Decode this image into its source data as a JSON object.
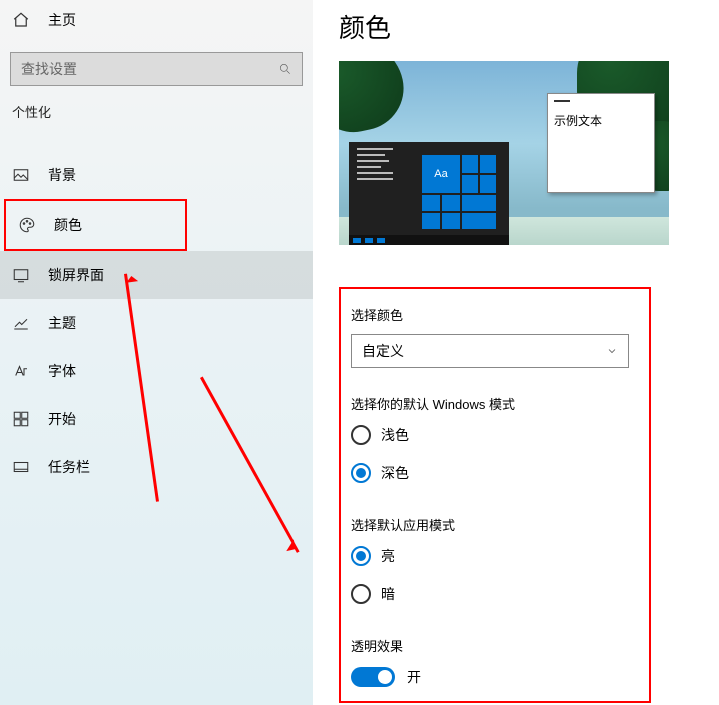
{
  "sidebar": {
    "home_label": "主页",
    "search_placeholder": "查找设置",
    "section_title": "个性化",
    "items": [
      {
        "label": "背景"
      },
      {
        "label": "颜色"
      },
      {
        "label": "锁屏界面"
      },
      {
        "label": "主题"
      },
      {
        "label": "字体"
      },
      {
        "label": "开始"
      },
      {
        "label": "任务栏"
      }
    ]
  },
  "main": {
    "title": "颜色",
    "preview": {
      "tile_label": "Aa",
      "sample_text": "示例文本"
    },
    "choose_color_label": "选择颜色",
    "choose_color_value": "自定义",
    "windows_mode_label": "选择你的默认 Windows 模式",
    "windows_mode_options": {
      "light": "浅色",
      "dark": "深色"
    },
    "app_mode_label": "选择默认应用模式",
    "app_mode_options": {
      "light": "亮",
      "dark": "暗"
    },
    "transparency_label": "透明效果",
    "transparency_state": "开"
  }
}
